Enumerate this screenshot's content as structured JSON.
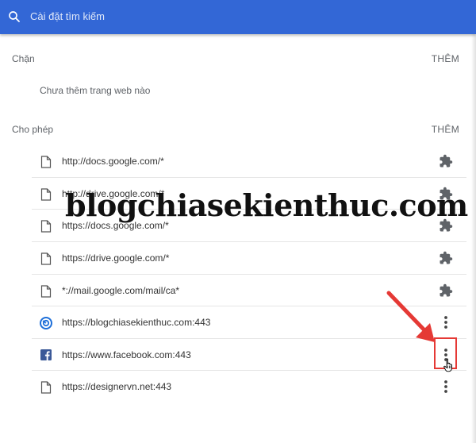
{
  "search": {
    "placeholder": "Cài đặt tìm kiếm",
    "icon": "search-icon"
  },
  "block_section": {
    "title": "Chặn",
    "add_label": "THÊM",
    "empty_text": "Chưa thêm trang web nào"
  },
  "allow_section": {
    "title": "Cho phép",
    "add_label": "THÊM",
    "items": [
      {
        "url": "http://docs.google.com/*",
        "icon": "file-icon",
        "action": "extension-puzzle-icon"
      },
      {
        "url": "http://drive.google.com/*",
        "icon": "file-icon",
        "action": "extension-puzzle-icon"
      },
      {
        "url": "https://docs.google.com/*",
        "icon": "file-icon",
        "action": "extension-puzzle-icon"
      },
      {
        "url": "https://drive.google.com/*",
        "icon": "file-icon",
        "action": "extension-puzzle-icon"
      },
      {
        "url": "*://mail.google.com/mail/ca*",
        "icon": "file-icon",
        "action": "extension-puzzle-icon"
      },
      {
        "url": "https://blogchiasekienthuc.com:443",
        "icon": "blogchiasekienthuc-favicon-icon",
        "action": "more-vert-icon"
      },
      {
        "url": "https://www.facebook.com:443",
        "icon": "facebook-icon",
        "action": "more-vert-icon"
      },
      {
        "url": "https://designervn.net:443",
        "icon": "file-icon",
        "action": "more-vert-icon"
      }
    ]
  },
  "watermark": "blogchiasekienthuc.com",
  "colors": {
    "header": "#3367d6",
    "annotation": "#e53935",
    "text": "#333333",
    "muted": "#5f6368"
  }
}
